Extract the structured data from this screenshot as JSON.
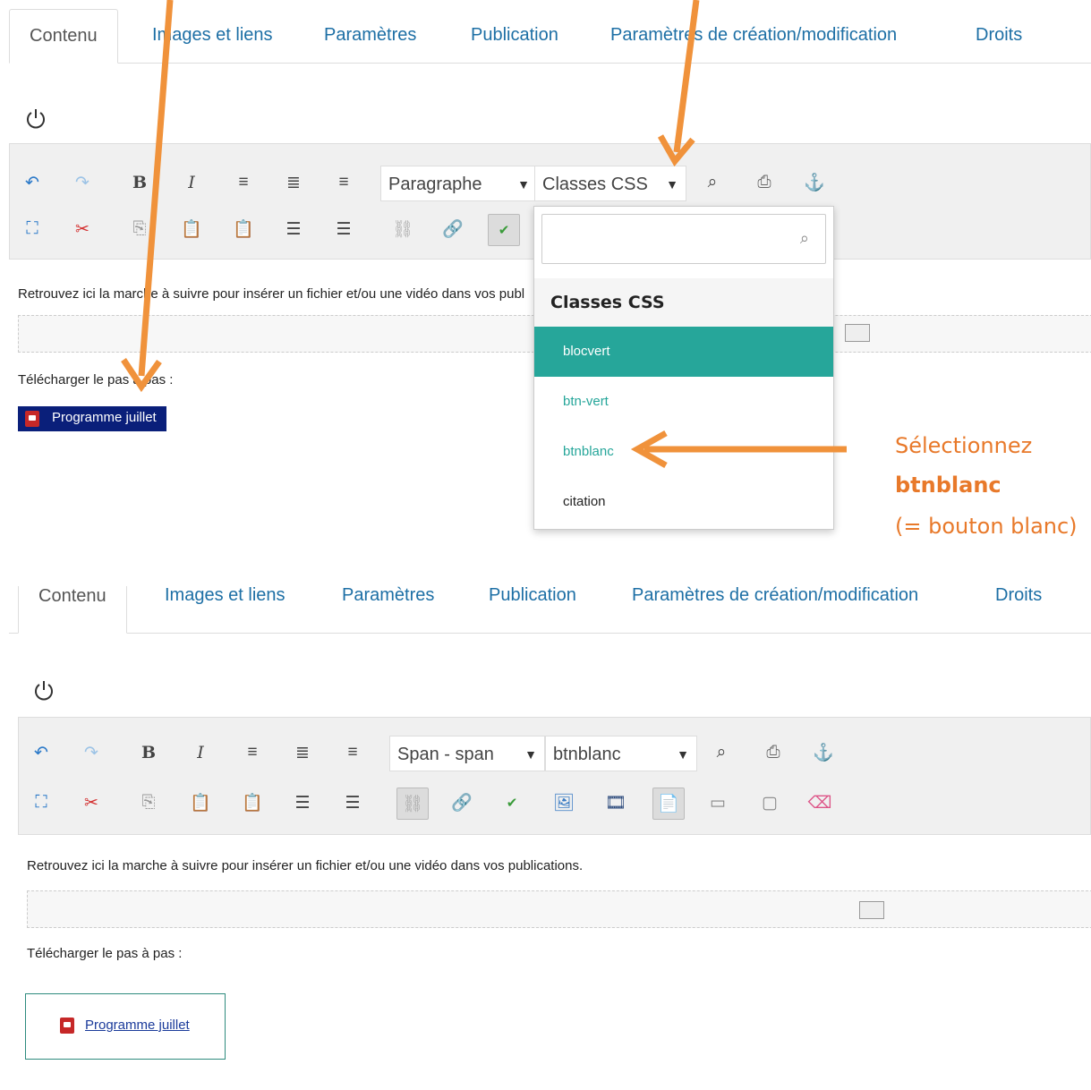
{
  "top": {
    "tabs": [
      "Contenu",
      "Images et liens",
      "Paramètres",
      "Publication",
      "Paramètres de création/modification",
      "Droits"
    ],
    "format_select": "Paragraphe",
    "class_select": "Classes CSS",
    "intro_text": "Retrouvez ici la marche à suivre pour insérer un fichier et/ou une vidéo dans vos publications.",
    "download_label": "Télécharger le pas à pas :",
    "link_text": "Programme juillet",
    "dropdown": {
      "search_placeholder": "",
      "header": "Classes CSS",
      "items": [
        {
          "label": "blocvert",
          "highlighted": true
        },
        {
          "label": "btn-vert",
          "highlighted": false
        },
        {
          "label": "btnblanc",
          "highlighted": false
        },
        {
          "label": "citation",
          "highlighted": false
        }
      ]
    }
  },
  "annotation": {
    "line1": "Sélectionnez",
    "line2": "btnblanc",
    "line3": "(= bouton blanc)",
    "color": "#e8792a"
  },
  "bottom": {
    "tabs": [
      "Contenu",
      "Images et liens",
      "Paramètres",
      "Publication",
      "Paramètres de création/modification",
      "Droits"
    ],
    "format_select": "Span - span",
    "class_select": "btnblanc",
    "intro_text": "Retrouvez ici la marche à suivre pour insérer un fichier et/ou une vidéo dans vos publications.",
    "download_label": "Télécharger le pas à pas :",
    "link_text": "Programme juillet"
  },
  "colors": {
    "tab_link": "#1d6fa5",
    "highlight": "#26a69a",
    "selection": "#0a1f7a",
    "arrow": "#f0923b"
  }
}
